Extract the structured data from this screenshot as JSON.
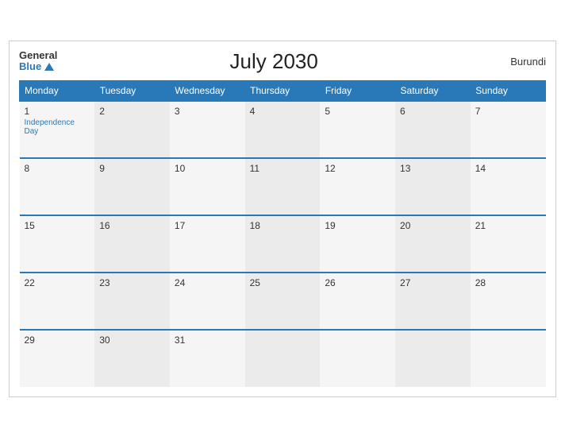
{
  "header": {
    "logo_general": "General",
    "logo_blue": "Blue",
    "title": "July 2030",
    "country": "Burundi"
  },
  "weekdays": [
    "Monday",
    "Tuesday",
    "Wednesday",
    "Thursday",
    "Friday",
    "Saturday",
    "Sunday"
  ],
  "weeks": [
    [
      {
        "day": "1",
        "holiday": "Independence Day"
      },
      {
        "day": "2"
      },
      {
        "day": "3"
      },
      {
        "day": "4"
      },
      {
        "day": "5"
      },
      {
        "day": "6"
      },
      {
        "day": "7"
      }
    ],
    [
      {
        "day": "8"
      },
      {
        "day": "9"
      },
      {
        "day": "10"
      },
      {
        "day": "11"
      },
      {
        "day": "12"
      },
      {
        "day": "13"
      },
      {
        "day": "14"
      }
    ],
    [
      {
        "day": "15"
      },
      {
        "day": "16"
      },
      {
        "day": "17"
      },
      {
        "day": "18"
      },
      {
        "day": "19"
      },
      {
        "day": "20"
      },
      {
        "day": "21"
      }
    ],
    [
      {
        "day": "22"
      },
      {
        "day": "23"
      },
      {
        "day": "24"
      },
      {
        "day": "25"
      },
      {
        "day": "26"
      },
      {
        "day": "27"
      },
      {
        "day": "28"
      }
    ],
    [
      {
        "day": "29"
      },
      {
        "day": "30"
      },
      {
        "day": "31"
      },
      {
        "day": ""
      },
      {
        "day": ""
      },
      {
        "day": ""
      },
      {
        "day": ""
      }
    ]
  ]
}
